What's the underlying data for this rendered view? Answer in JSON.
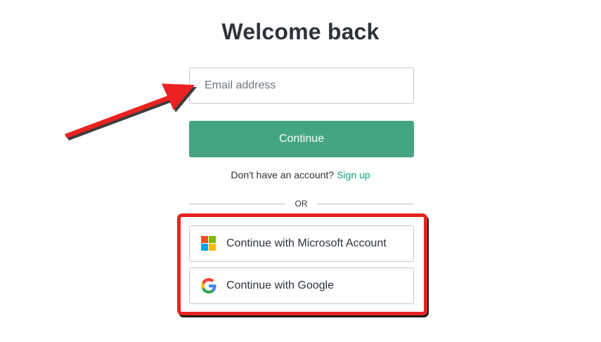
{
  "page": {
    "title": "Welcome back"
  },
  "email": {
    "placeholder": "Email address",
    "value": ""
  },
  "continue_label": "Continue",
  "signup": {
    "prompt": "Don't have an account?",
    "link_label": "Sign up"
  },
  "divider_label": "OR",
  "social": {
    "microsoft_label": "Continue with Microsoft Account",
    "google_label": "Continue with Google"
  },
  "icons": {
    "microsoft": "microsoft-logo-icon",
    "google": "google-logo-icon"
  },
  "colors": {
    "primary": "#43a680",
    "link": "#10a37f",
    "annotation_red": "#ec2121",
    "text": "#2d333a",
    "border": "#c2c8d0"
  }
}
